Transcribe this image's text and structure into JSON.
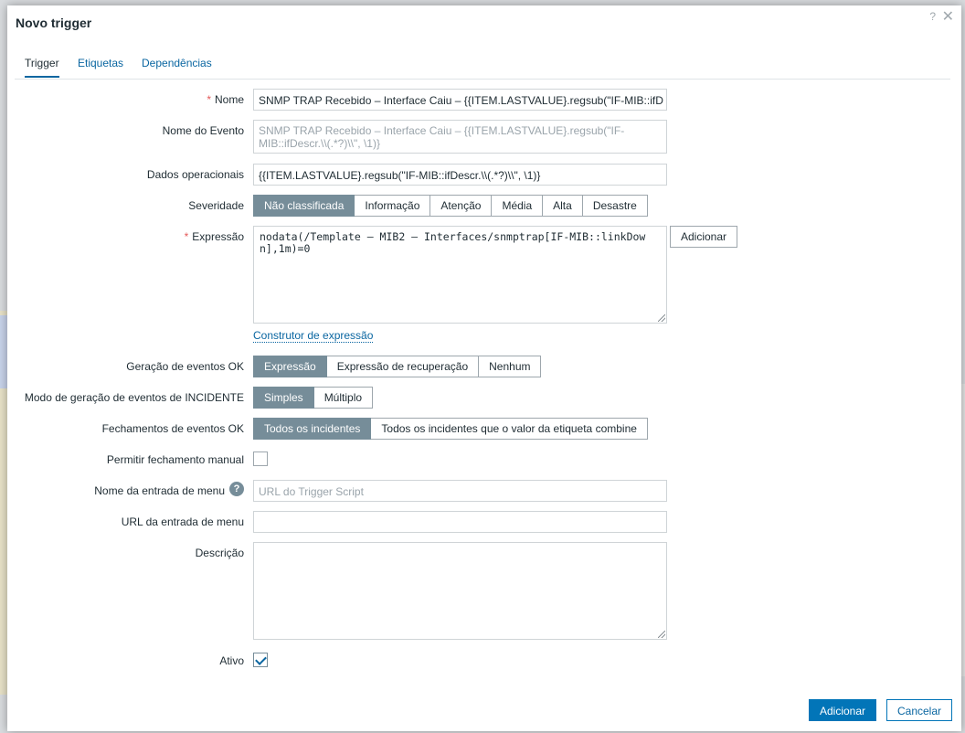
{
  "dialog": {
    "title": "Novo trigger"
  },
  "tabs": [
    {
      "label": "Trigger",
      "active": true
    },
    {
      "label": "Etiquetas",
      "active": false
    },
    {
      "label": "Dependências",
      "active": false
    }
  ],
  "form": {
    "name": {
      "label": "Nome",
      "required": true,
      "value": "SNMP TRAP Recebido – Interface Caiu – {{ITEM.LASTVALUE}.regsub(\"IF-MIB::ifD"
    },
    "event_name": {
      "label": "Nome do Evento",
      "placeholder": "SNMP TRAP Recebido – Interface Caiu – {{ITEM.LASTVALUE}.regsub(\"IF-MIB::ifDescr.\\\\(.*?)\\\\\", \\1)}"
    },
    "opdata": {
      "label": "Dados operacionais",
      "value": "{{ITEM.LASTVALUE}.regsub(\"IF-MIB::ifDescr.\\\\(.*?)\\\\\", \\1)}"
    },
    "severity": {
      "label": "Severidade",
      "options": [
        "Não classificada",
        "Informação",
        "Atenção",
        "Média",
        "Alta",
        "Desastre"
      ],
      "selected": "Não classificada"
    },
    "expression": {
      "label": "Expressão",
      "required": true,
      "value": "nodata(/Template – MIB2 – Interfaces/snmptrap[IF-MIB::linkDown],1m)=0",
      "add_button": "Adicionar",
      "builder_link": "Construtor de expressão"
    },
    "ok_event_generation": {
      "label": "Geração de eventos OK",
      "options": [
        "Expressão",
        "Expressão de recuperação",
        "Nenhum"
      ],
      "selected": "Expressão"
    },
    "problem_mode": {
      "label": "Modo de geração de eventos de INCIDENTE",
      "options": [
        "Simples",
        "Múltiplo"
      ],
      "selected": "Simples"
    },
    "ok_close": {
      "label": "Fechamentos de eventos OK",
      "options": [
        "Todos os incidentes",
        "Todos os incidentes que o valor da etiqueta combine"
      ],
      "selected": "Todos os incidentes"
    },
    "manual_close": {
      "label": "Permitir fechamento manual",
      "checked": false
    },
    "url_name": {
      "label": "Nome da entrada de menu",
      "placeholder": "URL do Trigger Script",
      "help_icon": "question-circle-icon"
    },
    "url": {
      "label": "URL da entrada de menu",
      "value": ""
    },
    "description": {
      "label": "Descrição",
      "value": ""
    },
    "enabled": {
      "label": "Ativo",
      "checked": true
    }
  },
  "footer": {
    "submit": "Adicionar",
    "cancel": "Cancelar"
  },
  "colors": {
    "accent": "#0275b8",
    "segment_selected": "#768d99",
    "required": "#e45959",
    "link": "#0a66a1"
  }
}
